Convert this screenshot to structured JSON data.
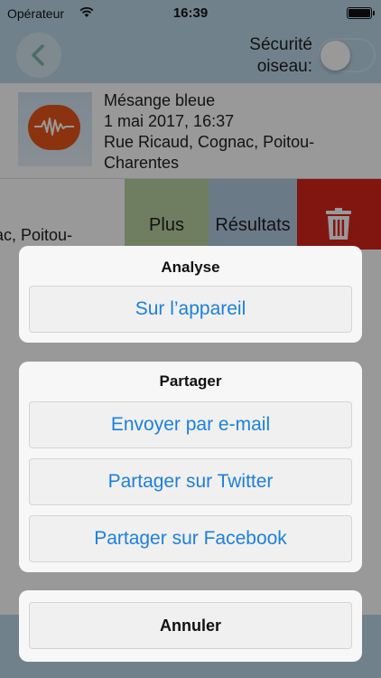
{
  "status_bar": {
    "carrier": "Opérateur",
    "time": "16:39",
    "wifi_icon": "wifi-icon",
    "battery_icon": "battery-icon"
  },
  "nav": {
    "back_icon": "chevron-left-icon",
    "safety_label": "Sécurité oiseau:",
    "safety_toggle_on": false
  },
  "record": {
    "thumb_icon": "sound-wave-bubble-icon",
    "lines": [
      "Mésange bleue",
      "1 mai 2017, 16:37",
      "Rue Ricaud, Cognac, Poitou-",
      "Charentes"
    ]
  },
  "swipe_row": {
    "text": "ac, Poitou-",
    "plus_label": "Plus",
    "results_label": "Résultats",
    "delete_icon": "trash-icon"
  },
  "action_sheet": {
    "analysis": {
      "title": "Analyse",
      "device_button": "Sur l’appareil"
    },
    "share": {
      "title": "Partager",
      "email_button": "Envoyer par e-mail",
      "twitter_button": "Partager sur Twitter",
      "facebook_button": "Partager sur Facebook"
    },
    "cancel_button": "Annuler"
  },
  "colors": {
    "header": "#bcd7e9",
    "plus": "#b9d3a2",
    "results": "#b3cbe2",
    "delete": "#d8261c",
    "thumb_bubble": "#e8561a",
    "sheet_link": "#1d7fe0"
  }
}
